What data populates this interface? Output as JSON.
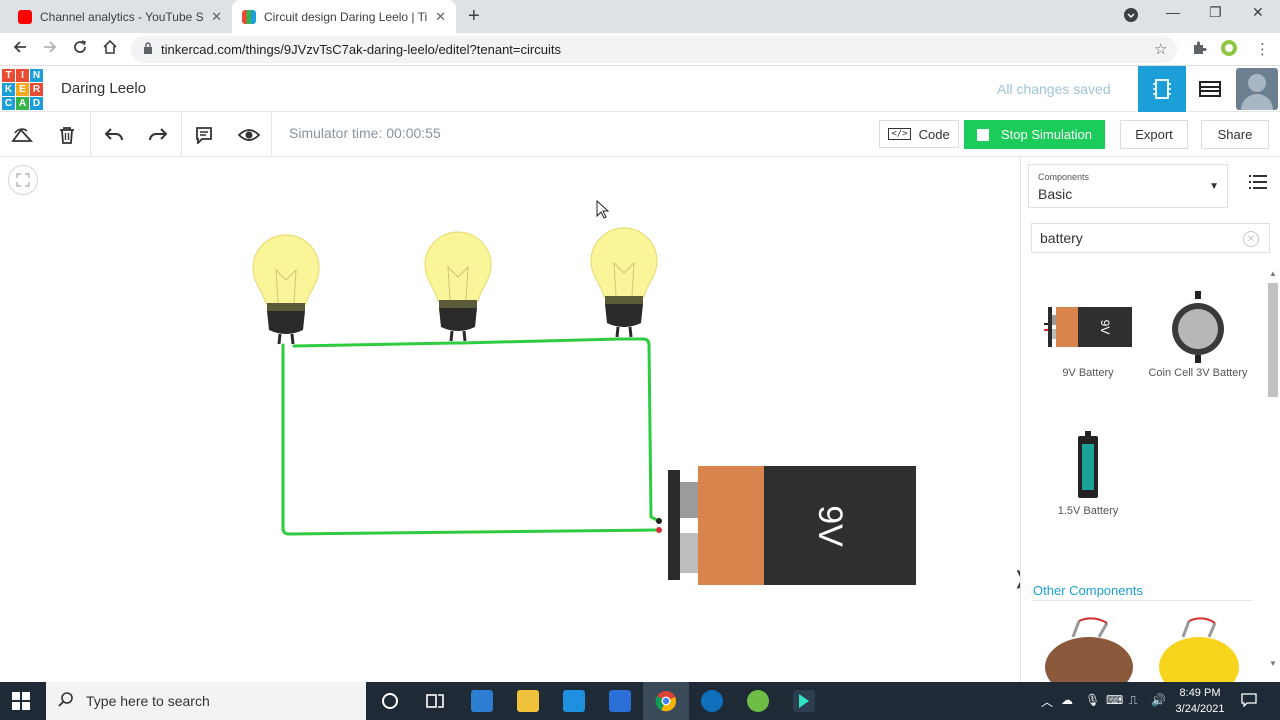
{
  "browser": {
    "tabs": [
      {
        "title": "Channel analytics - YouTube Studio",
        "close": "✕"
      },
      {
        "title": "Circuit design Daring Leelo | Tinkercad",
        "close": "✕"
      }
    ],
    "new_tab": "+",
    "url": "tinkercad.com/things/9JVzvTsC7ak-daring-leelo/editel?tenant=circuits",
    "window_controls": [
      "—",
      "❐",
      "✕"
    ]
  },
  "header": {
    "logo_letters": [
      "T",
      "I",
      "N",
      "K",
      "E",
      "R",
      "C",
      "A",
      "D"
    ],
    "logo_colors": [
      "#e94b35",
      "#e94b35",
      "#1c9ed8",
      "#1c9ed8",
      "#f7a81b",
      "#e94b35",
      "#1c9ed8",
      "#37b34a",
      "#1c9ed8"
    ],
    "design_name": "Daring Leelo",
    "save_status": "All changes saved"
  },
  "toolbar": {
    "simulator_time": "Simulator time: 00:00:55",
    "code_label": "Code",
    "code_icon_glyph": "</>",
    "stop_label": "Stop Simulation",
    "export_label": "Export",
    "share_label": "Share",
    "icons": [
      "rotate-icon",
      "trash-icon",
      "undo-icon",
      "redo-icon",
      "notes-icon",
      "visibility-icon"
    ]
  },
  "canvas": {
    "battery_label": "9V",
    "bulb_count": 3,
    "wire_color": "#2ecc40",
    "bulb_color": "#fbf59a"
  },
  "panel": {
    "components_caption": "Components",
    "components_value": "Basic",
    "search_value": "battery",
    "items": [
      {
        "label": "9V Battery"
      },
      {
        "label": "Coin Cell 3V Battery"
      },
      {
        "label": "1.5V Battery"
      }
    ],
    "other_title": "Other Components",
    "toggle_glyph": "❭"
  },
  "taskbar": {
    "search_placeholder": "Type here to search",
    "time": "8:49 PM",
    "date": "3/24/2021"
  },
  "colors": {
    "accent": "#1c9ed8",
    "simulate_green": "#1bcc5a"
  }
}
